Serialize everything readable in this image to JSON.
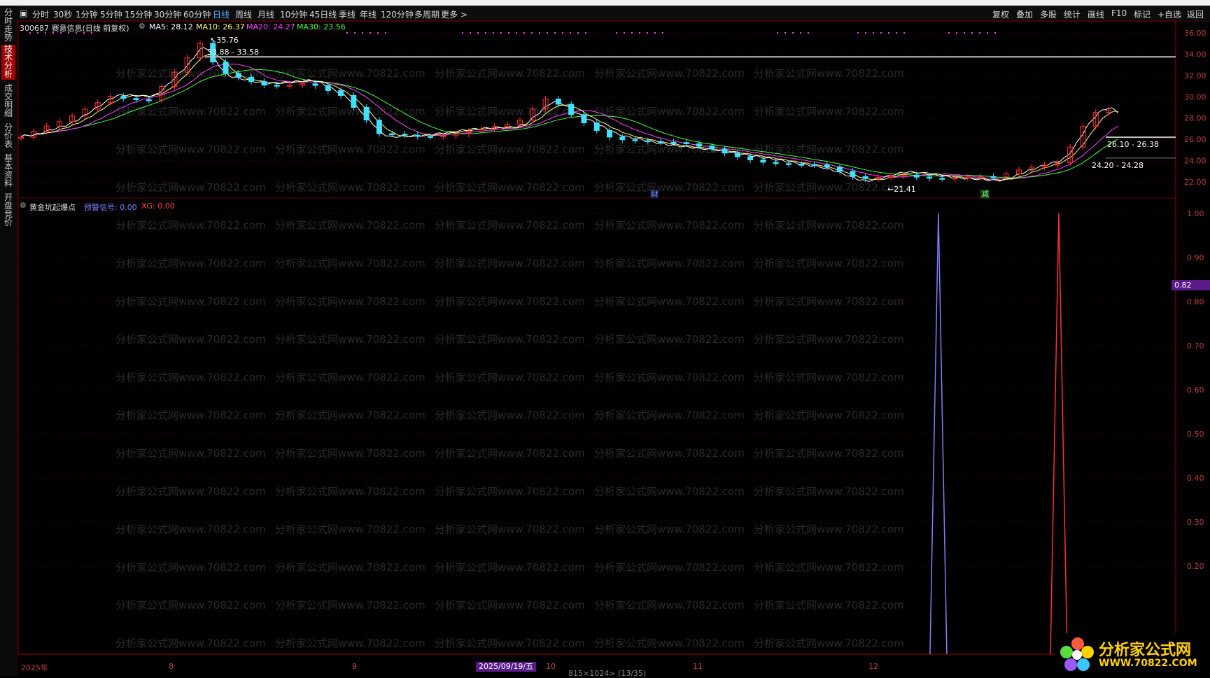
{
  "sidebar": {
    "tabs": [
      {
        "label": "分时走势",
        "active": false
      },
      {
        "label": "技术分析",
        "active": true
      },
      {
        "label": "成交明细",
        "active": false
      },
      {
        "label": "分价表",
        "active": false
      },
      {
        "label": "基本资料",
        "active": false
      },
      {
        "label": "开盘竞价",
        "active": false
      }
    ]
  },
  "toolbar": {
    "periods": [
      "分时",
      "30秒",
      "1分钟",
      "5分钟",
      "15分钟",
      "30分钟",
      "60分钟",
      "日线",
      "周线",
      "月线",
      "10分钟",
      "45日线",
      "季线",
      "年线",
      "120分钟",
      "多周期",
      "更多 >"
    ],
    "active_period": "日线",
    "right_items": [
      "复权",
      "叠加",
      "多股",
      "统计",
      "画线",
      "F10",
      "标记",
      "+自选",
      "返回"
    ]
  },
  "main_chart": {
    "stock_title": "300687 赛意信息(日线 前复权)",
    "ma5": "MA5: 28.12",
    "ma10": "MA10: 26.37",
    "ma20": "MA20: 24.27",
    "ma30": "MA30: 23.56",
    "colors": {
      "ma5": "#ffffff",
      "ma10": "#ffff80",
      "ma20": "#ff40ff",
      "ma30": "#40ff40",
      "up": "#ff3030",
      "down": "#40e0ff"
    },
    "y_ticks": [
      "36.00",
      "34.00",
      "32.00",
      "30.00",
      "28.00",
      "26.00",
      "24.00",
      "22.00"
    ],
    "annotations": {
      "high": "35.76",
      "resistance": "33.88 - 33.58",
      "low": "21.41",
      "zone1": "26.10 - 26.38",
      "zone2": "24.20 - 24.28",
      "marker_cai": "财",
      "marker_jian": "减"
    },
    "watermark": "分析家公式网www.70822.com"
  },
  "indicator": {
    "name": "黄金坑起爆点",
    "signal_label": "预警信号: 0.00",
    "xg_label": "XG: 0.00",
    "y_ticks": [
      "1.00",
      "0.90",
      "0.80",
      "0.70",
      "0.60",
      "0.50",
      "0.40",
      "0.30",
      "0.20"
    ],
    "current_value": "0.82",
    "spikes": [
      {
        "x_frac": 0.795,
        "value": 1.0,
        "color": "#8080ff"
      },
      {
        "x_frac": 0.899,
        "value": 1.0,
        "color": "#ff3030"
      }
    ]
  },
  "time_axis": {
    "labels": [
      "2025年",
      "8",
      "9",
      "10",
      "11",
      "12"
    ],
    "cursor_date": "2025/09/19/五",
    "footer": "815×1024> (13/35)"
  },
  "logo": {
    "title": "分析家公式网",
    "url": "WWW.70822.COM"
  }
}
